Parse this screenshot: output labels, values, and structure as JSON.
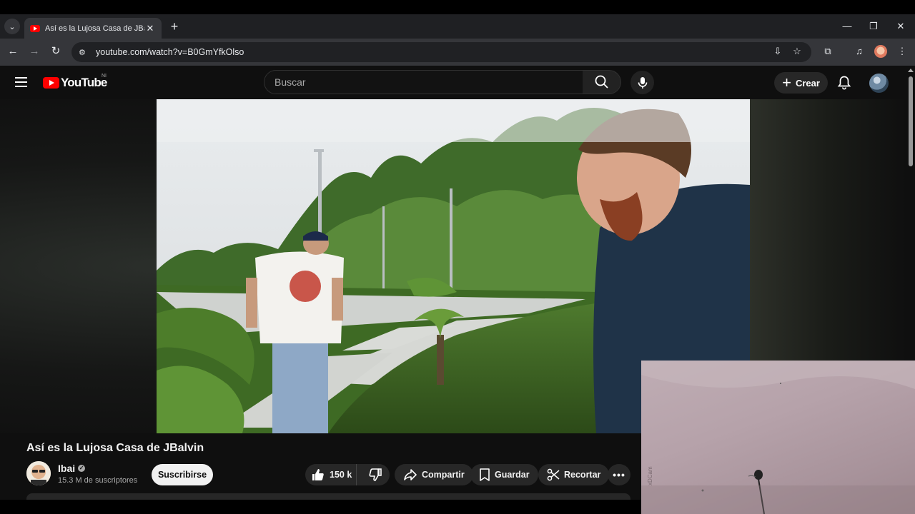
{
  "browser": {
    "tab_title": "Así es la Lujosa Casa de JBalvin",
    "url": "youtube.com/watch?v=B0GmYfkOlso"
  },
  "youtube": {
    "logo_text": "YouTube",
    "country_code": "NI",
    "search_placeholder": "Buscar",
    "create_label": "Crear"
  },
  "video": {
    "title": "Así es la Lujosa Casa de JBalvin",
    "channel_name": "Ibai",
    "subscribers": "15.3 M de suscriptores",
    "subscribe_label": "Suscribirse",
    "likes": "150 k",
    "share_label": "Compartir",
    "save_label": "Guardar",
    "clip_label": "Recortar"
  },
  "webcam": {
    "watermark": "xDCam"
  }
}
